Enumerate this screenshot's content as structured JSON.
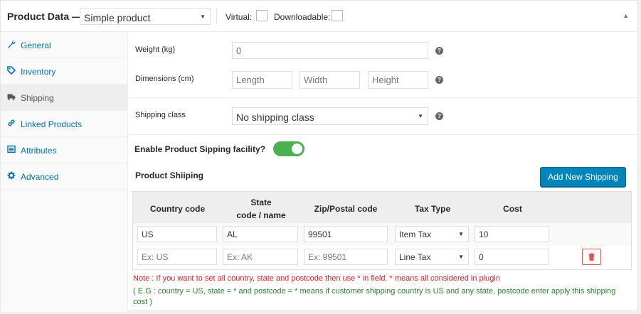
{
  "header": {
    "title": "Product Data —",
    "product_type": "Simple product",
    "virtual_label": "Virtual:",
    "downloadable_label": "Downloadable:"
  },
  "sidebar": {
    "items": [
      {
        "label": "General",
        "icon": "wrench-icon"
      },
      {
        "label": "Inventory",
        "icon": "tag-icon"
      },
      {
        "label": "Shipping",
        "icon": "truck-icon",
        "active": true
      },
      {
        "label": "Linked Products",
        "icon": "link-icon"
      },
      {
        "label": "Attributes",
        "icon": "list-icon"
      },
      {
        "label": "Advanced",
        "icon": "gear-icon"
      }
    ]
  },
  "shipping": {
    "weight_label": "Weight (kg)",
    "weight_placeholder": "0",
    "dimensions_label": "Dimensions (cm)",
    "length_placeholder": "Length",
    "width_placeholder": "Width",
    "height_placeholder": "Height",
    "class_label": "Shipping class",
    "class_value": "No shipping class",
    "help_glyph": "?"
  },
  "facility": {
    "label": "Enable Product Sipping facility?",
    "enabled": true
  },
  "product_shipping": {
    "title": "Product Shiiping",
    "add_button": "Add New Shipping",
    "columns": {
      "country": "Country code",
      "state_line1": "State",
      "state_line2": "code / name",
      "zip": "Zip/Postal code",
      "tax": "Tax Type",
      "cost": "Cost"
    },
    "rows": [
      {
        "country": "US",
        "state": "AL",
        "zip": "99501",
        "tax": "Item Tax",
        "cost": "10"
      },
      {
        "country_placeholder": "Ex: US",
        "state_placeholder": "Ex: AK",
        "zip_placeholder": "Ex: 99501",
        "tax": "Line Tax",
        "cost": "0"
      }
    ]
  },
  "notes": {
    "red": "Note : If you want to set all country, state and postcode then use * in field. * means all considered in plugin",
    "green": "( E.G : country = US, state = * and postcode = * means if customer shipping country is US and any state, postcode enter apply this shipping cost )"
  },
  "colors": {
    "accent": "#0085ba",
    "link": "#0073aa",
    "toggle_on": "#4caf50",
    "note_red": "#e02020",
    "note_green": "#2e7d32",
    "delete": "#e35353"
  }
}
